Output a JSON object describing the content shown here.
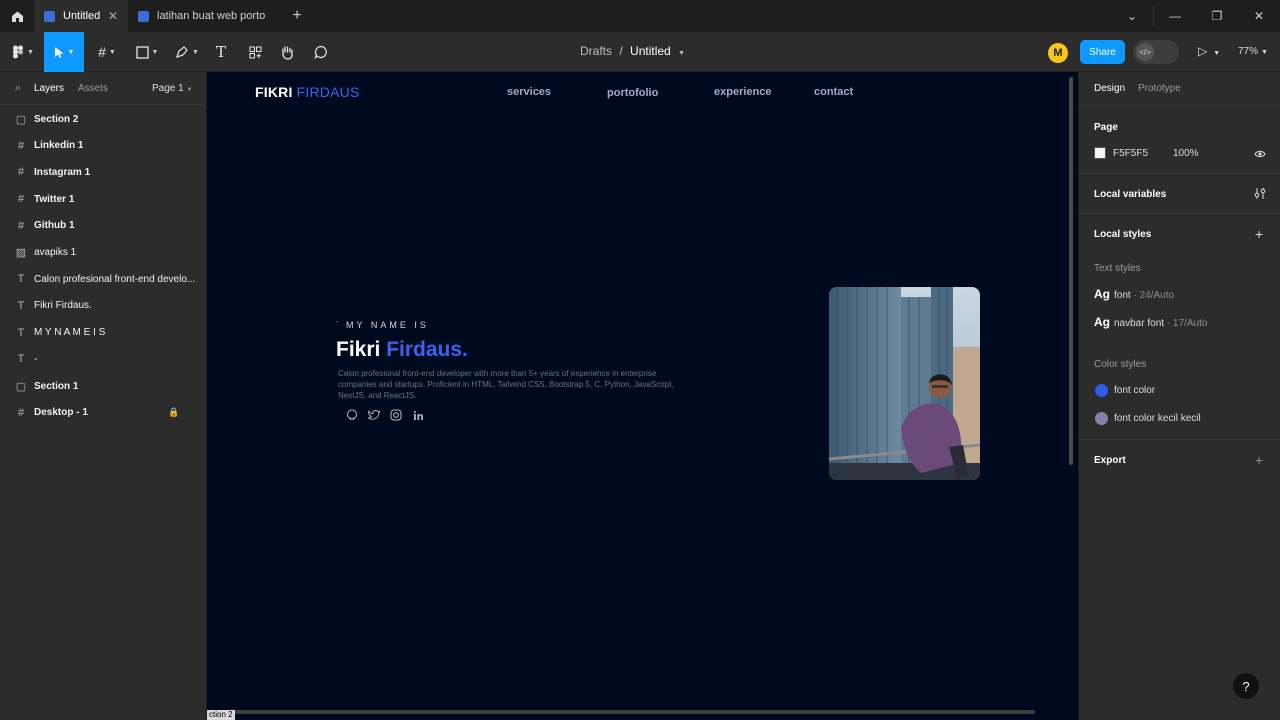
{
  "browser": {
    "tabs": [
      {
        "label": "Untitled",
        "active": true
      },
      {
        "label": "latihan buat web porto",
        "active": false
      }
    ],
    "new_tab": "+",
    "controls": {
      "dropdown": "⌄",
      "minimize": "—",
      "restore": "❐",
      "close": "✕"
    }
  },
  "toolbar": {
    "breadcrumb": {
      "parent": "Drafts",
      "sep": "/",
      "current": "Untitled"
    },
    "avatar_initial": "M",
    "share_label": "Share",
    "devmode_label": "</>",
    "zoom": "77%"
  },
  "layers_panel": {
    "tab_layers": "Layers",
    "tab_assets": "Assets",
    "page": "Page 1",
    "items": [
      {
        "name": "Section 2",
        "icon": "section-icon",
        "bold": true
      },
      {
        "name": "Linkedin 1",
        "icon": "frame-icon",
        "bold": true
      },
      {
        "name": "Instagram 1",
        "icon": "frame-icon",
        "bold": true
      },
      {
        "name": "Twitter 1",
        "icon": "frame-icon",
        "bold": true
      },
      {
        "name": "Github 1",
        "icon": "frame-icon",
        "bold": true
      },
      {
        "name": "avapiks 1",
        "icon": "image-icon",
        "bold": false
      },
      {
        "name": "Calon profesional front-end develo...",
        "icon": "text-icon",
        "bold": false
      },
      {
        "name": "Fikri Firdaus.",
        "icon": "text-icon",
        "bold": false
      },
      {
        "name": "M Y N A M E I S",
        "icon": "text-icon",
        "bold": false
      },
      {
        "name": "-",
        "icon": "text-icon",
        "bold": false
      },
      {
        "name": "Section 1",
        "icon": "section-icon",
        "bold": true
      },
      {
        "name": "Desktop - 1",
        "icon": "frame-icon",
        "bold": true
      }
    ]
  },
  "canvas": {
    "logo_first": "FIKRI",
    "logo_last": "FIRDAUS",
    "nav": [
      "services",
      "portofolio",
      "experience",
      "contact"
    ],
    "dash": "-",
    "my_name_is": "MY NAME IS",
    "hero_first": "Fikri",
    "hero_last": "Firdaus.",
    "description": "Calon profesional front-end developer with more than 5+ years of experience in enterprise companies and startups. Proficient in HTML, Tailwind CSS, Bootstrap 5, C, Python, JavaScript, NextJS, and ReactJS.",
    "section_label": "ction 2"
  },
  "design_panel": {
    "tab_design": "Design",
    "tab_prototype": "Prototype",
    "page_title": "Page",
    "page_color": "F5F5F5",
    "page_opacity": "100%",
    "local_variables": "Local variables",
    "local_styles": "Local styles",
    "text_styles_title": "Text styles",
    "text_styles": [
      {
        "sample": "Ag",
        "name": "font",
        "spec": " · 24/Auto"
      },
      {
        "sample": "Ag",
        "name": "navbar font",
        "spec": " · 17/Auto"
      }
    ],
    "color_styles_title": "Color styles",
    "color_styles": [
      {
        "name": "font color",
        "color": "#2f5be8"
      },
      {
        "name": "font color kecil kecil",
        "color": "#8a7fa6"
      }
    ],
    "export": "Export",
    "help": "?"
  },
  "colors": {
    "accent": "#0d99ff",
    "canvas_bg": "#000a1e",
    "brand_blue": "#3b63f2"
  }
}
